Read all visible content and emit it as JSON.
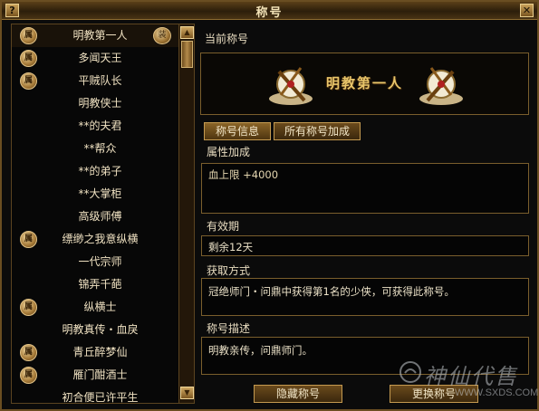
{
  "window": {
    "title": "称号"
  },
  "titlebar": {
    "help_label": "?",
    "close_label": "✕"
  },
  "title_list": {
    "badge_char": "属",
    "selected_index": 0,
    "items": [
      {
        "label": "明教第一人",
        "badge": true,
        "right_badge": "装"
      },
      {
        "label": "多闻天王",
        "badge": true
      },
      {
        "label": "平贼队长",
        "badge": true
      },
      {
        "label": "明教侠士",
        "badge": false
      },
      {
        "label": "**的夫君",
        "badge": false
      },
      {
        "label": "**帮众",
        "badge": false
      },
      {
        "label": "**的弟子",
        "badge": false
      },
      {
        "label": "**大掌柜",
        "badge": false
      },
      {
        "label": "高级师傅",
        "badge": false
      },
      {
        "label": "缥缈之我意纵横",
        "badge": true
      },
      {
        "label": "一代宗师",
        "badge": false
      },
      {
        "label": "锦弄千葩",
        "badge": false
      },
      {
        "label": "纵横士",
        "badge": true
      },
      {
        "label": "明教真传・血戾",
        "badge": false
      },
      {
        "label": "青丘醉梦仙",
        "badge": true
      },
      {
        "label": "雁门酣酒士",
        "badge": true
      },
      {
        "label": "初合便已许平生",
        "badge": false
      }
    ]
  },
  "scrollbar": {
    "up_label": "▲",
    "down_label": "▼"
  },
  "current_title": {
    "section_label": "当前称号",
    "name": "明教第一人"
  },
  "tabs": [
    {
      "label": "称号信息",
      "active": true
    },
    {
      "label": "所有称号加成",
      "active": false
    }
  ],
  "attributes": {
    "section_label": "属性加成",
    "text": "血上限 +4000"
  },
  "validity": {
    "section_label": "有效期",
    "text": "剩余12天"
  },
  "obtain": {
    "section_label": "获取方式",
    "text": "冠绝师门・问鼎中获得第1名的少侠，可获得此称号。"
  },
  "description": {
    "section_label": "称号描述",
    "text": "明教亲传，问鼎师门。"
  },
  "buttons": {
    "hide": "隐藏称号",
    "change": "更换称号"
  },
  "watermark": {
    "text": "神仙代售",
    "url": "WWW.SXDS.COM"
  },
  "colors": {
    "accent": "#c49a50",
    "title_gold": "#e8c56a",
    "border": "#7a5e2c"
  }
}
